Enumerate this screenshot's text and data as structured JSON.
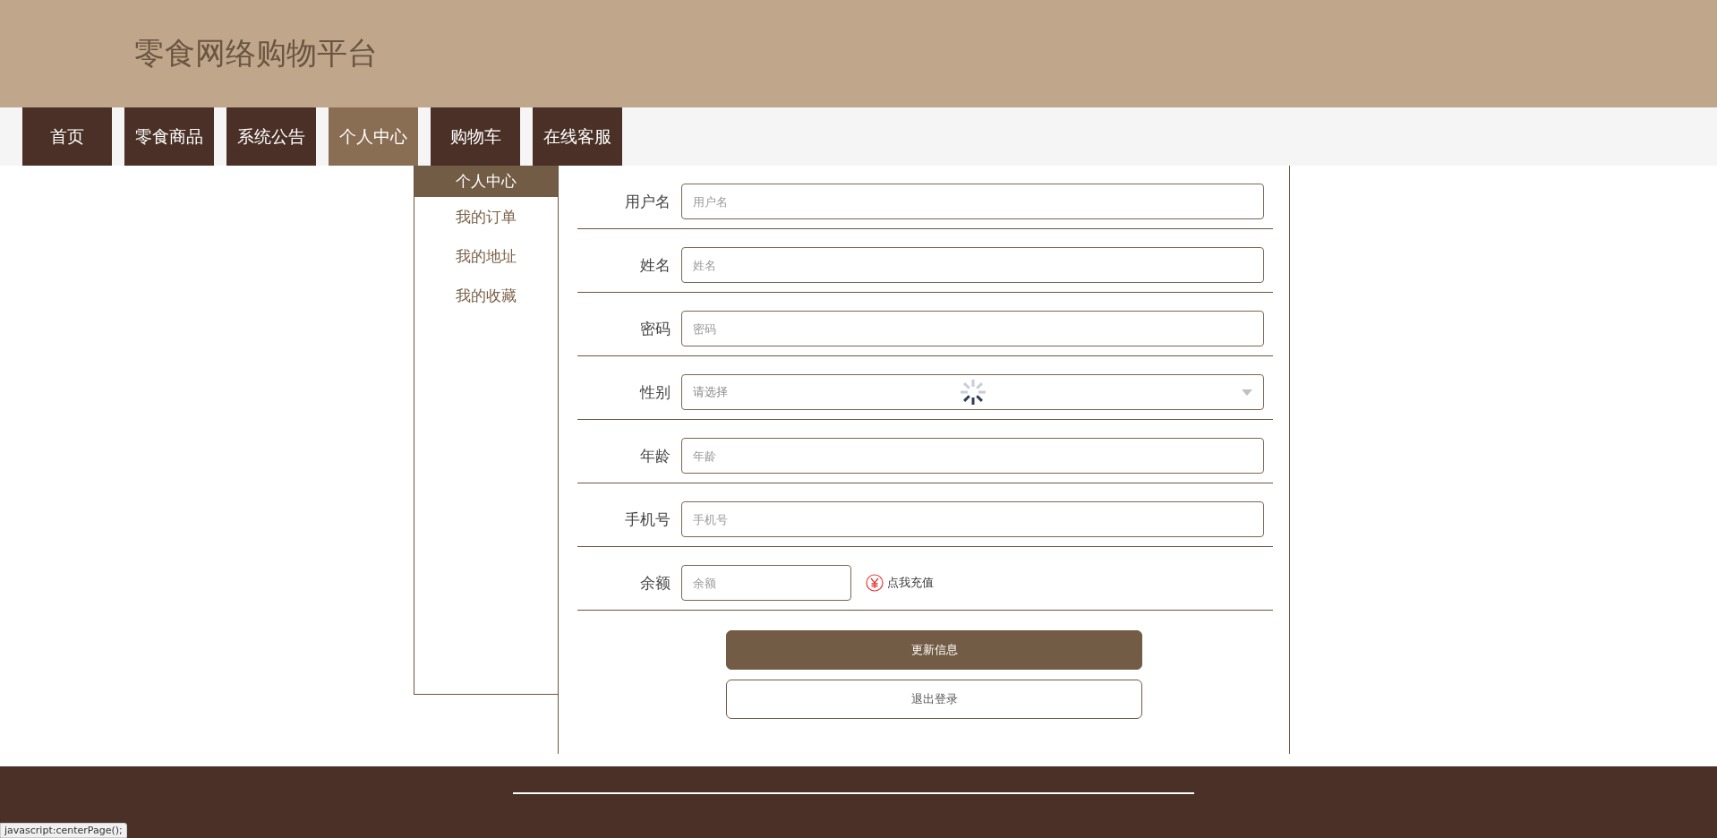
{
  "header": {
    "title": "零食网络购物平台"
  },
  "nav": [
    {
      "label": "首页",
      "selected": false
    },
    {
      "label": "零食商品",
      "selected": false
    },
    {
      "label": "系统公告",
      "selected": false
    },
    {
      "label": "个人中心",
      "selected": true
    },
    {
      "label": "购物车",
      "selected": false
    },
    {
      "label": "在线客服",
      "selected": false
    }
  ],
  "sidebar": [
    {
      "label": "个人中心",
      "selected": true
    },
    {
      "label": "我的订单",
      "selected": false
    },
    {
      "label": "我的地址",
      "selected": false
    },
    {
      "label": "我的收藏",
      "selected": false
    }
  ],
  "form": {
    "fields": [
      {
        "kind": "text",
        "label": "用户名",
        "placeholder": "用户名"
      },
      {
        "kind": "text",
        "label": "姓名",
        "placeholder": "姓名"
      },
      {
        "kind": "password",
        "label": "密码",
        "placeholder": "密码"
      },
      {
        "kind": "select",
        "label": "性别",
        "placeholder": "请选择"
      },
      {
        "kind": "text",
        "label": "年龄",
        "placeholder": "年龄"
      },
      {
        "kind": "text",
        "label": "手机号",
        "placeholder": "手机号"
      },
      {
        "kind": "balance",
        "label": "余额",
        "placeholder": "余额",
        "action": "点我充值"
      }
    ],
    "buttons": [
      {
        "kind": "primary",
        "label": "更新信息"
      },
      {
        "kind": "secondary",
        "label": "退出登录"
      }
    ]
  },
  "status_bar": {
    "text": "javascript:centerPage();"
  }
}
